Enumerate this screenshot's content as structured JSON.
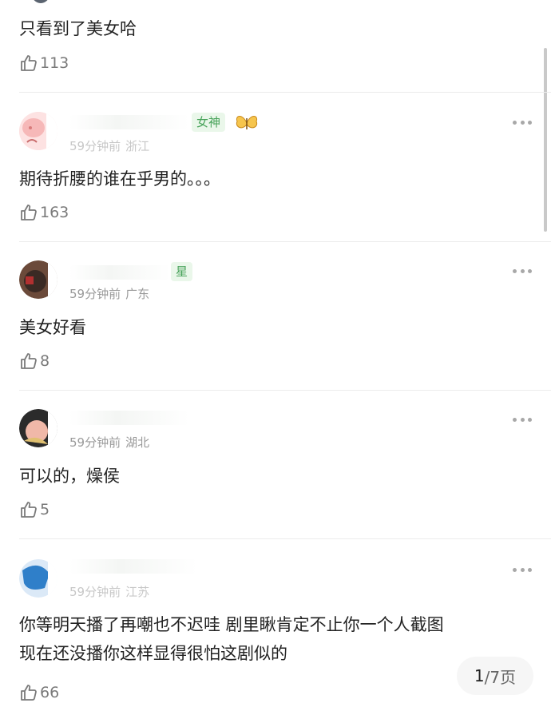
{
  "comments": [
    {
      "text": "只看到了美女哈",
      "likes": "113"
    },
    {
      "badge": "女神",
      "time": "59分钟前",
      "location": "浙江",
      "text": "期待折腰的谁在乎男的。。。",
      "likes": "163"
    },
    {
      "badge": "星",
      "time": "59分钟前",
      "location": "广东",
      "text": "美女好看",
      "likes": "8"
    },
    {
      "time": "59分钟前",
      "location": "湖北",
      "text": "可以的，燥侯",
      "likes": "5"
    },
    {
      "time": "59分钟前",
      "location": "江苏",
      "text_line1": "你等明天播了再嘲也不迟哇 剧里瞅肯定不止你一个人截图",
      "text_line2": "现在还没播你这样显得很怕这剧似的",
      "likes": "66"
    }
  ],
  "icons": {
    "like": "thumbs-up-icon",
    "more": "more-dots-icon",
    "badge_decoration": "butterfly-icon"
  },
  "pager": {
    "current": "1",
    "total_label": "/7页"
  },
  "colors": {
    "text": "#222222",
    "meta": "#9a9a9a",
    "badge_bg": "#eaf7ea",
    "badge_text": "#48a35a",
    "butterfly": "#f2b53a"
  }
}
